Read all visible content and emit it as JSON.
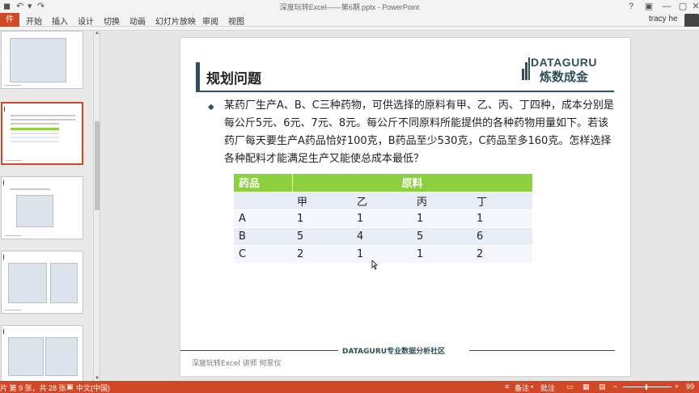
{
  "window": {
    "title": "深度玩转Excel——第6期.pptx - PowerPoint",
    "user": "tracy he",
    "controls": {
      "help": "?",
      "ribbon_options": "▣",
      "minimize": "—",
      "maximize": "▢",
      "close": "✕"
    }
  },
  "quick_access": {
    "save": "◼",
    "undo": "↶",
    "redo": "↷",
    "customize": "▾"
  },
  "ribbon": {
    "file_tab": "件",
    "tabs": [
      "开始",
      "插入",
      "设计",
      "切换",
      "动画",
      "幻灯片放映",
      "审阅",
      "视图"
    ]
  },
  "slide": {
    "title": "规划问题",
    "logo": {
      "english": "DATAGURU",
      "chinese": "炼数成金"
    },
    "bullet_glyph": "◆",
    "body": "某药厂生产A、B、C三种药物，可供选择的原料有甲、乙、丙、丁四种，成本分别是每公斤5元、6元、7元、8元。每公斤不同原料所能提供的各种药物用量如下。若该药厂每天要生产A药品恰好100克，B药品至少530克，C药品至多160克。怎样选择各种配料才能满足生产又能使总成本最低？",
    "table": {
      "header_left": "药品",
      "header_group": "原料",
      "materials": [
        "甲",
        "乙",
        "丙",
        "丁"
      ],
      "rows": [
        {
          "drug": "A",
          "values": [
            "1",
            "1",
            "1",
            "1"
          ]
        },
        {
          "drug": "B",
          "values": [
            "5",
            "4",
            "5",
            "6"
          ]
        },
        {
          "drug": "C",
          "values": [
            "2",
            "1",
            "1",
            "2"
          ]
        }
      ]
    },
    "footer_community": "DATAGURU专业数据分析社区",
    "footer_left": "深度玩转Excel   讲师 何翠仪"
  },
  "status": {
    "slide_position": "片 第 9 张，共 28 张",
    "language": "中文(中国)",
    "notes": "备注",
    "comments": "批注",
    "zoom_minus": "−",
    "zoom_plus": "+",
    "zoom_value": "99"
  },
  "colors": {
    "brand_red": "#d24726",
    "table_header_green": "#8ccf3f",
    "accent_dark_teal": "#2e4f5a"
  }
}
